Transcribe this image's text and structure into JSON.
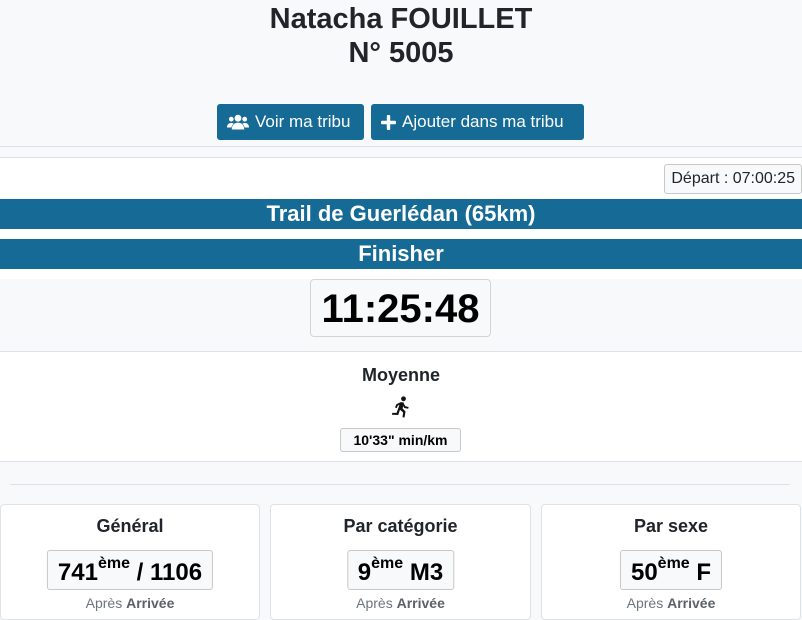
{
  "athlete": {
    "name": "Natacha FOUILLET",
    "bib": "N° 5005"
  },
  "actions": {
    "tribu_label": "Voir ma tribu",
    "add_label": "Ajouter dans ma tribu"
  },
  "race": {
    "depart": "Départ : 07:00:25",
    "title": "Trail de Guerlédan (65km)",
    "status": "Finisher",
    "time": "11:25:48"
  },
  "average": {
    "label": "Moyenne",
    "pace": "10'33\" min/km"
  },
  "rankings": [
    {
      "title": "Général",
      "rank": "741",
      "suffix": "ème",
      "rest": " / 1106",
      "after_prefix": "Après",
      "after_point": "Arrivée"
    },
    {
      "title": "Par catégorie",
      "rank": "9",
      "suffix": "ème",
      "rest": " M3",
      "after_prefix": "Après",
      "after_point": "Arrivée"
    },
    {
      "title": "Par sexe",
      "rank": "50",
      "suffix": "ème",
      "rest": " F",
      "after_prefix": "Après",
      "after_point": "Arrivée"
    }
  ],
  "icons": {
    "tribu": "users-icon",
    "add": "plus-icon",
    "runner": "running-icon"
  },
  "colors": {
    "accent": "#156b96"
  }
}
